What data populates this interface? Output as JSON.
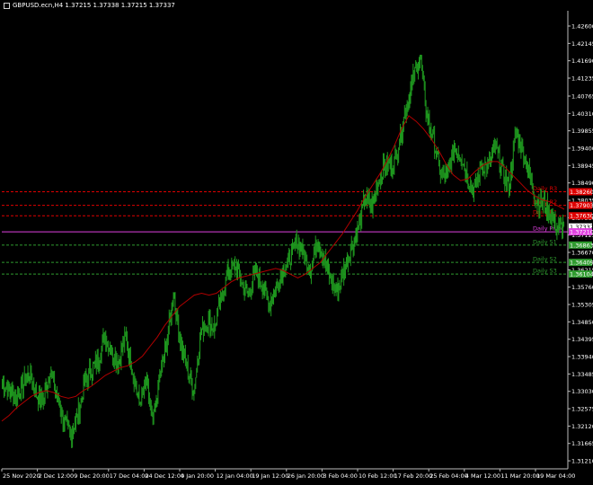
{
  "window": {
    "title": "GBPUSD.ecn,H4  1.37215 1.37338 1.37215 1.37337"
  },
  "colors": {
    "background": "#000000",
    "candles": "#1f9a1f",
    "moving_average": "#b00000",
    "resistance": "#ff2a2a",
    "pivot": "#d020d0",
    "support": "#2f9b2f",
    "axis_text": "#ffffff",
    "grid": "#2a2a2a"
  },
  "levels": [
    {
      "label": "Daily R3",
      "value": 1.3826,
      "type": "resistance",
      "color": "#e00000"
    },
    {
      "label": "Daily R2",
      "value": 1.37903,
      "type": "resistance",
      "color": "#e00000"
    },
    {
      "label": "Daily R1",
      "value": 1.3763,
      "type": "resistance",
      "color": "#e00000"
    },
    {
      "label": "Current",
      "value": 1.37337,
      "type": "price",
      "color": "#ffffff"
    },
    {
      "label": "Daily Pivot",
      "value": 1.3721,
      "type": "pivot",
      "color": "#e040e0"
    },
    {
      "label": "Daily S1",
      "value": 1.36863,
      "type": "support",
      "color": "#2f9b2f"
    },
    {
      "label": "Daily S2",
      "value": 1.36409,
      "type": "support",
      "color": "#2f9b2f"
    },
    {
      "label": "Daily S3",
      "value": 1.36104,
      "type": "support",
      "color": "#2f9b2f"
    }
  ],
  "chart_data": {
    "type": "line",
    "title": "GBPUSD.ecn,H4  1.37215 1.37338 1.37215 1.37337",
    "xlabel": "",
    "ylabel": "",
    "ylim": [
      1.31,
      1.43
    ],
    "y_ticks": [
      "1.43055",
      "1.42600",
      "1.42145",
      "1.41690",
      "1.41235",
      "1.40765",
      "1.40310",
      "1.39855",
      "1.39400",
      "1.38945",
      "1.38490",
      "1.38035",
      "1.37580",
      "1.37125",
      "1.36670",
      "1.36215",
      "1.35760",
      "1.35305",
      "1.34850",
      "1.34395",
      "1.33940",
      "1.33485",
      "1.33030",
      "1.32575",
      "1.32120",
      "1.31665",
      "1.31210"
    ],
    "x_ticks": [
      "25 Nov 2020",
      "2 Dec 12:00",
      "9 Dec 20:00",
      "17 Dec 04:00",
      "24 Dec 12:00",
      "4 Jan 20:00",
      "12 Jan 04:00",
      "19 Jan 12:00",
      "26 Jan 20:00",
      "3 Feb 04:00",
      "10 Feb 12:00",
      "17 Feb 20:00",
      "25 Feb 04:00",
      "4 Mar 12:00",
      "11 Mar 20:00",
      "19 Mar 04:00"
    ],
    "series": [
      {
        "values": [
          1.333,
          1.3305,
          1.3285,
          1.332,
          1.335,
          1.3295,
          1.328,
          1.336,
          1.329,
          1.3225,
          1.319,
          1.324,
          1.332,
          1.336,
          1.3385,
          1.345,
          1.3405,
          1.338,
          1.3445,
          1.336,
          1.327,
          1.3325,
          1.3215,
          1.334,
          1.3425,
          1.356,
          1.3435,
          1.3365,
          1.3305,
          1.346,
          1.3485,
          1.347,
          1.3545,
          1.362,
          1.363,
          1.3585,
          1.3555,
          1.362,
          1.358,
          1.353,
          1.3575,
          1.362,
          1.365,
          1.37,
          1.366,
          1.362,
          1.37,
          1.365,
          1.359,
          1.3565,
          1.363,
          1.368,
          1.373,
          1.381,
          1.379,
          1.386,
          1.39,
          1.389,
          1.396,
          1.405,
          1.412,
          1.418,
          1.4025,
          1.396,
          1.3875,
          1.3865,
          1.3945,
          1.392,
          1.386,
          1.383,
          1.3895,
          1.389,
          1.3945,
          1.388,
          1.384,
          1.398,
          1.3935,
          1.387,
          1.38,
          1.3795,
          1.377,
          1.373,
          1.3734
        ]
      },
      {
        "values": [
          1.3225,
          1.324,
          1.326,
          1.3275,
          1.329,
          1.33,
          1.3305,
          1.33,
          1.329,
          1.3285,
          1.329,
          1.3305,
          1.3315,
          1.333,
          1.3345,
          1.3355,
          1.3365,
          1.337,
          1.338,
          1.3395,
          1.342,
          1.3445,
          1.3475,
          1.35,
          1.3525,
          1.354,
          1.3555,
          1.356,
          1.3555,
          1.356,
          1.3575,
          1.359,
          1.36,
          1.3605,
          1.361,
          1.3615,
          1.362,
          1.3625,
          1.362,
          1.361,
          1.36,
          1.361,
          1.3625,
          1.364,
          1.3665,
          1.369,
          1.3715,
          1.3745,
          1.3775,
          1.381,
          1.384,
          1.387,
          1.3905,
          1.3945,
          1.399,
          1.4025,
          1.401,
          1.399,
          1.3965,
          1.3935,
          1.39,
          1.387,
          1.3855,
          1.386,
          1.388,
          1.3895,
          1.3905,
          1.3905,
          1.389,
          1.387,
          1.385,
          1.383,
          1.3815,
          1.3805,
          1.38,
          1.379,
          1.378
        ]
      }
    ],
    "levels_visible": true
  }
}
